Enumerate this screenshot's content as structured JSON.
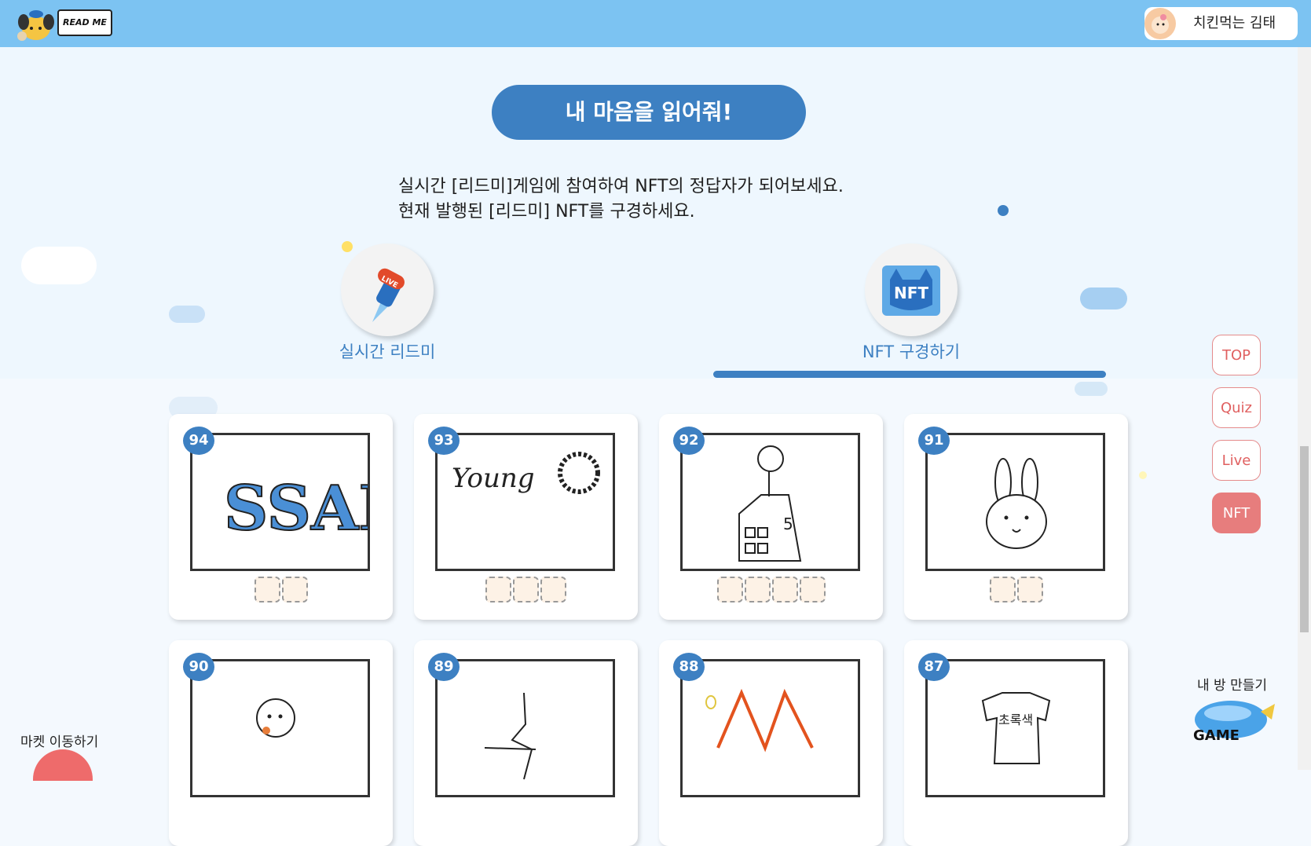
{
  "header": {
    "logo_text": "READ ME",
    "user_name": "치킨먹는 김태"
  },
  "hero": {
    "title": "내 마음을 읽어줘!",
    "intro_line1": "실시간 [리드미]게임에 참여하여 NFT의 정답자가 되어보세요.",
    "intro_line2": "현재 발행된 [리드미] NFT를 구경하세요."
  },
  "tabs": [
    {
      "label": "실시간 리드미",
      "badge": "LIVE",
      "icon": "paintbrush-rocket-icon"
    },
    {
      "label": "NFT 구경하기",
      "badge": "NFT",
      "icon": "nft-cat-notebook-icon",
      "active": true
    }
  ],
  "cards_row1": [
    {
      "number": "94",
      "slots": 2,
      "drawing": "SSAFY"
    },
    {
      "number": "93",
      "slots": 3,
      "drawing": "Young"
    },
    {
      "number": "92",
      "slots": 4,
      "drawing": "building-5"
    },
    {
      "number": "91",
      "slots": 2,
      "drawing": "rabbit"
    }
  ],
  "cards_row2": [
    {
      "number": "90",
      "drawing": "dog"
    },
    {
      "number": "89",
      "drawing": "figure"
    },
    {
      "number": "88",
      "drawing": "orange-M"
    },
    {
      "number": "87",
      "drawing": "초록색 shirt",
      "shirt_text": "초록색"
    }
  ],
  "side_nav": [
    "TOP",
    "Quiz",
    "Live",
    "NFT"
  ],
  "corner": {
    "market_label": "마켓 이동하기",
    "room_label": "내 방 만들기",
    "game_label": "GAME"
  },
  "colors": {
    "header": "#7cc3f2",
    "primary": "#3d80c2",
    "accent": "#e77d7d"
  }
}
